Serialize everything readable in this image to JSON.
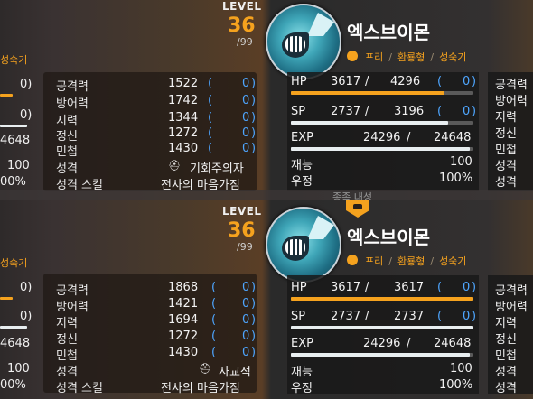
{
  "cards": [
    {
      "level_label": "LEVEL",
      "level": "36",
      "level_max": "/99",
      "digimon_name": "엑스브이몬",
      "tags": [
        "프리",
        "환룡형",
        "성숙기"
      ],
      "stats": [
        {
          "label": "공격력",
          "value": "1522",
          "bonus": "0"
        },
        {
          "label": "방어력",
          "value": "1742",
          "bonus": "0"
        },
        {
          "label": "지력",
          "value": "1344",
          "bonus": "0"
        },
        {
          "label": "정신",
          "value": "1272",
          "bonus": "0"
        },
        {
          "label": "민첩",
          "value": "1430",
          "bonus": "0"
        }
      ],
      "personality_label": "성격",
      "personality": "기회주의자",
      "skill_label": "성격 스킬",
      "skill": "전사의 마음가짐",
      "hp_label": "HP",
      "hp_cur": "3617",
      "hp_max": "4296",
      "hp_bonus": "0",
      "hp_fill": 0.84,
      "sp_label": "SP",
      "sp_cur": "2737",
      "sp_max": "3196",
      "sp_bonus": "0",
      "sp_fill": 0.86,
      "exp_label": "EXP",
      "exp_cur": "24296",
      "exp_max": "24648",
      "exp_fill": 0.98,
      "talent_label": "재능",
      "talent": "100",
      "friendship_label": "우정",
      "friendship": "100%",
      "left_edge": {
        "tag": "성숙기",
        "paren": "0)",
        "exp": "4648",
        "talent": "100",
        "friendship": "00%"
      },
      "right_edge": {
        "labels": [
          "공격력",
          "방어력",
          "지력",
          "정신",
          "민첩",
          "성격",
          "성격"
        ]
      },
      "blur_text": "종족 내성"
    },
    {
      "level_label": "LEVEL",
      "level": "36",
      "level_max": "/99",
      "digimon_name": "엑스브이몬",
      "tags": [
        "프리",
        "환룡형",
        "성숙기"
      ],
      "stats": [
        {
          "label": "공격력",
          "value": "1868",
          "bonus": "0"
        },
        {
          "label": "방어력",
          "value": "1421",
          "bonus": "0"
        },
        {
          "label": "지력",
          "value": "1694",
          "bonus": "0"
        },
        {
          "label": "정신",
          "value": "1272",
          "bonus": "0"
        },
        {
          "label": "민첩",
          "value": "1430",
          "bonus": "0"
        }
      ],
      "personality_label": "성격",
      "personality": "사교적",
      "skill_label": "성격 스킬",
      "skill": "전사의 마음가짐",
      "hp_label": "HP",
      "hp_cur": "3617",
      "hp_max": "3617",
      "hp_bonus": "0",
      "hp_fill": 1.0,
      "sp_label": "SP",
      "sp_cur": "2737",
      "sp_max": "2737",
      "sp_bonus": "0",
      "sp_fill": 1.0,
      "exp_label": "EXP",
      "exp_cur": "24296",
      "exp_max": "24648",
      "exp_fill": 0.98,
      "talent_label": "재능",
      "talent": "100",
      "friendship_label": "우정",
      "friendship": "100%",
      "left_edge": {
        "tag": "성숙기",
        "paren": "0)",
        "exp": "4648",
        "talent": "100",
        "friendship": "00%"
      },
      "right_edge": {
        "labels": [
          "공격력",
          "방어력",
          "지력",
          "정신",
          "민첩",
          "성격",
          "성격"
        ]
      }
    }
  ],
  "colors": {
    "accent": "#f5a21e",
    "paren_blue": "#4ea6ff",
    "text": "#f2f2f2"
  },
  "icons": {
    "personality": "personality-icon",
    "badge": "attribute-badge-icon",
    "shield": "resistance-shield-icon"
  }
}
